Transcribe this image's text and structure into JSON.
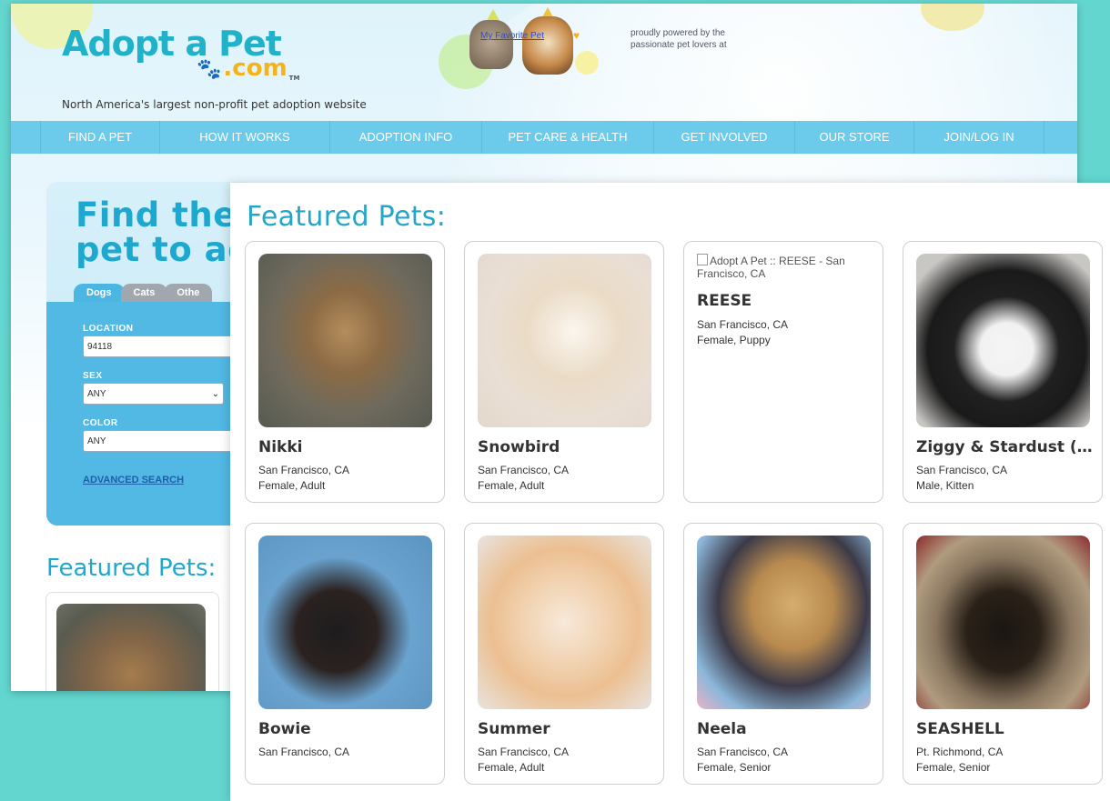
{
  "site": {
    "logo_main": "Adopt a Pet",
    "logo_domain": "com",
    "logo_tm": "TM",
    "tagline": "North America's largest non-profit pet adoption website",
    "fav_promo_link": "My Favorite Pet",
    "powered_by": "proudly powered by the passionate pet lovers at",
    "nav": [
      {
        "label": "FIND A PET",
        "width": 130
      },
      {
        "label": "HOW IT WORKS",
        "width": 186
      },
      {
        "label": "ADOPTION INFO",
        "width": 166
      },
      {
        "label": "PET CARE & HEALTH",
        "width": 188
      },
      {
        "label": "GET INVOLVED",
        "width": 154
      },
      {
        "label": "OUR STORE",
        "width": 130
      },
      {
        "label": "JOIN/LOG IN",
        "width": 142
      }
    ],
    "find_title_line1": "Find the",
    "find_title_line2": "pet to ad",
    "tabs": [
      "Dogs",
      "Cats",
      "Othe"
    ],
    "location_label": "LOCATION",
    "location_value": "94118",
    "sex_label": "SEX",
    "sex_value": "ANY",
    "color_label": "COLOR",
    "color_value": "ANY",
    "advanced_search": "ADVANCED SEARCH",
    "featured_heading": "Featured Pets:"
  },
  "featured": {
    "heading": "Featured Pets:",
    "pets": [
      {
        "name": "Nikki",
        "location": "San Francisco, CA",
        "info": "Female, Adult",
        "photo": "ph-nikki"
      },
      {
        "name": "Snowbird",
        "location": "San Francisco, CA",
        "info": "Female, Adult",
        "photo": "ph-snow"
      },
      {
        "name": "REESE",
        "location": "San Francisco, CA",
        "info": "Female, Puppy",
        "photo": "",
        "alt": "Adopt A Pet :: REESE - San Francisco, CA"
      },
      {
        "name": "Ziggy & Stardust (…",
        "location": "San Francisco, CA",
        "info": "Male, Kitten",
        "photo": "ph-ziggy"
      },
      {
        "name": "Bowie",
        "location": "San Francisco, CA",
        "info": "",
        "photo": "ph-bowie"
      },
      {
        "name": "Summer",
        "location": "San Francisco, CA",
        "info": "Female, Adult",
        "photo": "ph-summer"
      },
      {
        "name": "Neela",
        "location": "San Francisco, CA",
        "info": "Female, Senior",
        "photo": "ph-neela"
      },
      {
        "name": "SEASHELL",
        "location": "Pt. Richmond, CA",
        "info": "Female, Senior",
        "photo": "ph-seashell"
      }
    ]
  },
  "colors": {
    "page_background": "#63d6cf",
    "brand_teal": "#1fb2c9",
    "brand_orange": "#f6b21a",
    "nav_blue": "#6ccbea",
    "form_blue": "#51b9e4",
    "heading_blue": "#23a6c9"
  }
}
